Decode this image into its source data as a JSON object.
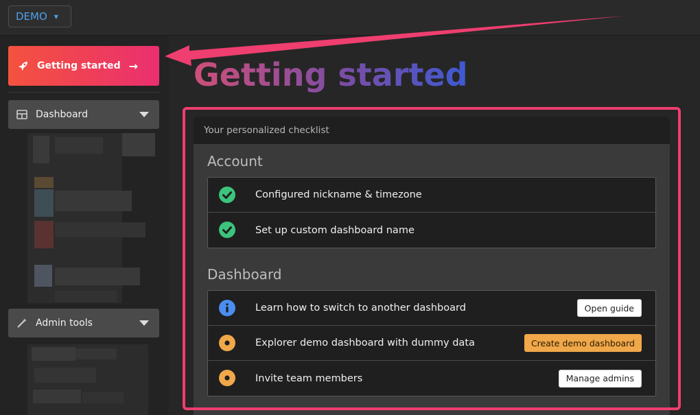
{
  "topbar": {
    "workspace": "DEMO"
  },
  "sidebar": {
    "getting_started": "Getting started",
    "sections": [
      {
        "label": "Dashboard"
      },
      {
        "label": "Admin tools"
      }
    ]
  },
  "main": {
    "title": "Getting started",
    "card_header": "Your personalized checklist",
    "account": {
      "title": "Account",
      "items": [
        {
          "text": "Configured nickname & timezone",
          "status": "done"
        },
        {
          "text": "Set up custom dashboard name",
          "status": "done"
        }
      ]
    },
    "dashboard": {
      "title": "Dashboard",
      "items": [
        {
          "text": "Learn how to switch to another dashboard",
          "status": "info",
          "action": "Open guide"
        },
        {
          "text": "Explorer demo dashboard with dummy data",
          "status": "pending",
          "action": "Create demo dashboard"
        },
        {
          "text": "Invite team members",
          "status": "pending",
          "action": "Manage admins"
        }
      ]
    }
  },
  "colors": {
    "accent_gradient_start": "#f4523e",
    "accent_gradient_end": "#ea2f6f",
    "highlight": "#ef3e70",
    "done": "#3cc47c",
    "info": "#4b8ef0",
    "pending": "#f0a84a"
  },
  "icons": {
    "rocket": "rocket-icon",
    "dashboard": "grid-icon",
    "admin": "magic-wand-icon",
    "done": "check-circle-icon",
    "info": "info-circle-icon",
    "pending": "dot-circle-icon"
  }
}
